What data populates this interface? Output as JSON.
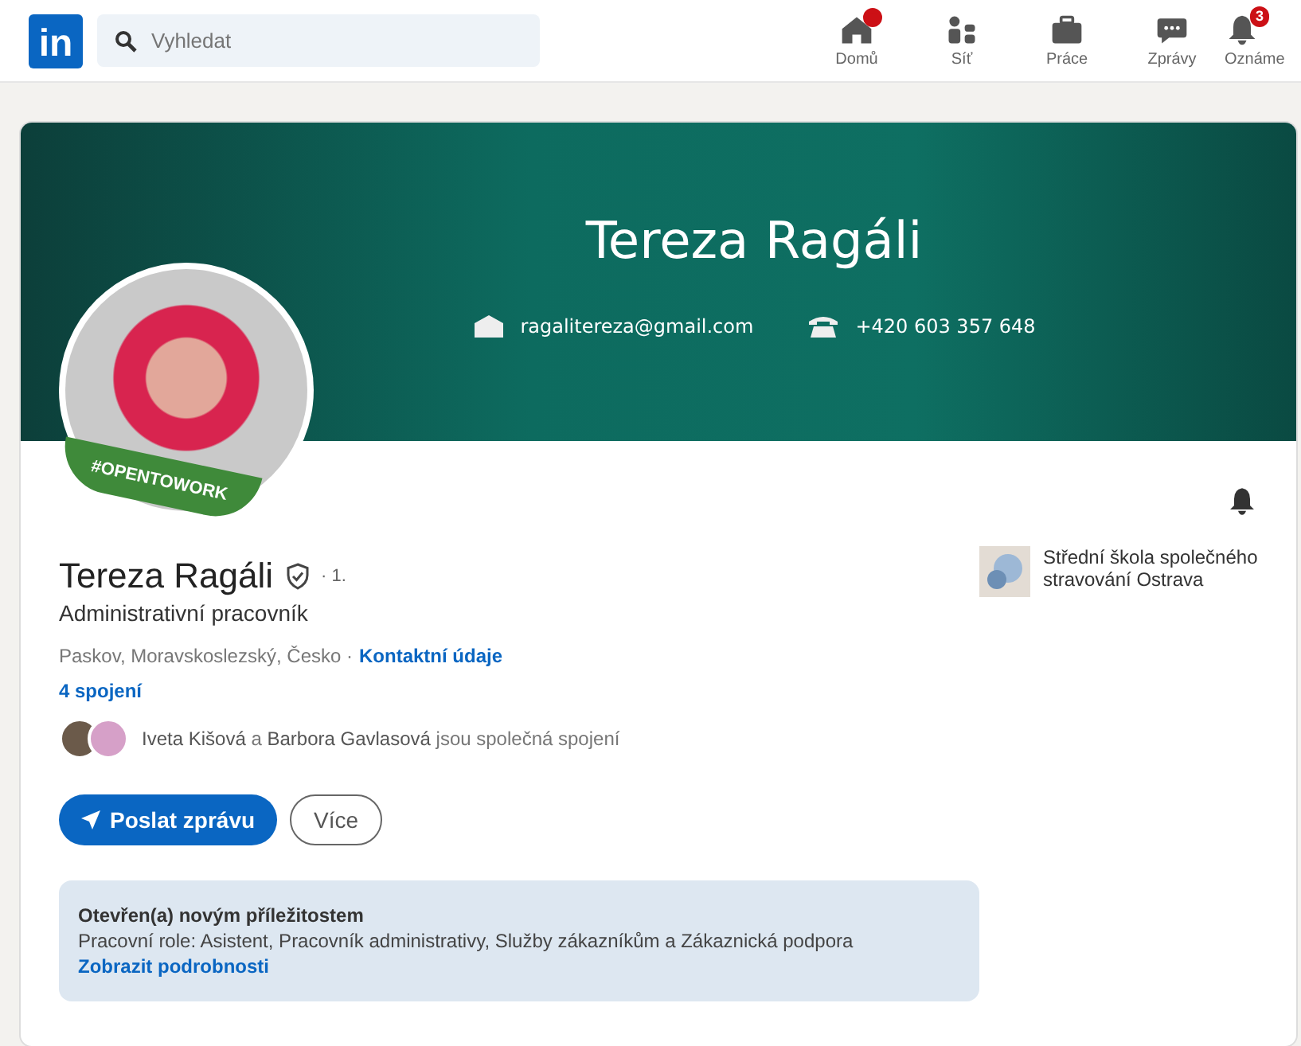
{
  "header": {
    "logo": "in",
    "search": {
      "placeholder": "Vyhledat"
    },
    "nav": [
      {
        "label": "Domů",
        "kind": "home",
        "dot": true
      },
      {
        "label": "Síť",
        "kind": "network",
        "dot": false
      },
      {
        "label": "Práce",
        "kind": "jobs",
        "dot": false
      },
      {
        "label": "Zprávy",
        "kind": "messages",
        "dot": false
      },
      {
        "label": "Oznáme",
        "kind": "notifications",
        "dot": false,
        "badge": "3"
      }
    ]
  },
  "banner": {
    "title": "Tereza Ragáli",
    "email": "ragalitereza@gmail.com",
    "phone": "+420 603 357 648"
  },
  "avatar": {
    "frame_label": "#OPENTOWORK"
  },
  "profile": {
    "name": "Tereza Ragáli",
    "degree": "· 1.",
    "headline": "Administrativní pracovník",
    "location": "Paskov, Moravskoslezský, Česko ·",
    "contact_link": "Kontaktní údaje",
    "connections": "4 spojení",
    "mutual": "**Iveta Kišová** a **Barbora Gavlasová** jsou společná spojení"
  },
  "school": {
    "name": "Střední škola společného stravování Ostrava"
  },
  "buttons": [
    {
      "label": "Poslat zprávu",
      "kind": "primary"
    },
    {
      "label": "Více",
      "kind": "secondary"
    }
  ],
  "open_to_work": {
    "title": "Otevřen(a) novým příležitostem",
    "roles": "Pracovní role: Asistent, Pracovník administrativy, Služby zákazníkům a Zákaznická podpora",
    "link": "Zobrazit podrobnosti"
  }
}
